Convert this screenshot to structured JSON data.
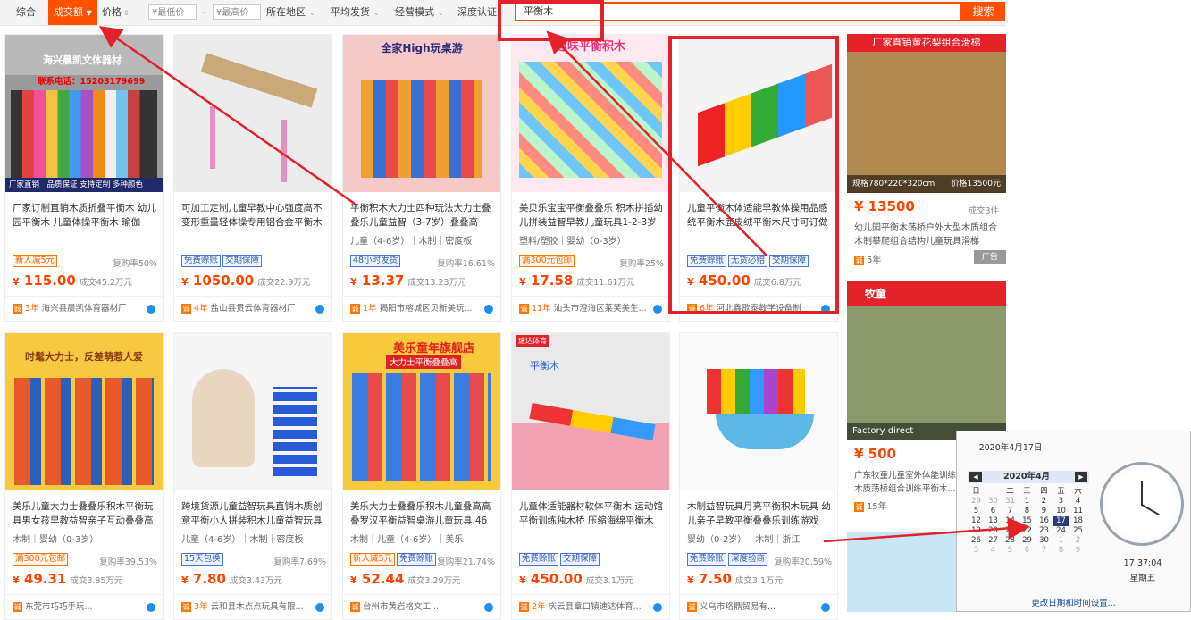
{
  "filters": {
    "zonghe": "综合",
    "chengjiao": "成交额",
    "jiage": "价格",
    "min_price": "¥最低价",
    "dash": "–",
    "max_price": "¥最高价",
    "region": "所在地区",
    "avg_ship": "平均发货",
    "mode": "经营模式",
    "cert": "深度认证"
  },
  "search": {
    "value": "平衡木",
    "button": "搜索"
  },
  "products": [
    {
      "title": "厂家订制直销木质折叠平衡木 幼儿园平衡木 儿童体操平衡木 瑜伽",
      "badges": [
        [
          "新人减5元",
          "o"
        ]
      ],
      "repurchase": "复购率50%",
      "price": "115.00",
      "sales": "成交45.2万元",
      "years": "3年",
      "shop": "海兴县晨凯体育器材厂",
      "img_top": "海兴晨凯文体器材",
      "img_top2": "联系电话：15203179699",
      "img_bottom": "厂家直销　品质保证 支持定制 多种颜色"
    },
    {
      "title": "可加工定制儿童早教中心强度高不变形重量轻体操专用铝合金平衡木",
      "badges": [
        [
          "免费赊账",
          "b"
        ],
        [
          "交期保障",
          "b"
        ]
      ],
      "repurchase": "",
      "price": "1050.00",
      "sales": "成交22.9万元",
      "years": "4年",
      "shop": "盐山县贯云体育器材厂"
    },
    {
      "title": "平衡积木大力士四种玩法大力士叠叠乐儿童益智（3-7岁）叠叠高",
      "spec": "儿童（4-6岁）｜木制｜密度板",
      "badges": [
        [
          "48小时发货",
          "b"
        ]
      ],
      "repurchase": "复购率16.61%",
      "price": "13.37",
      "sales": "成交13.23万元",
      "years": "1年",
      "shop": "揭阳市榕城区贝新美玩...",
      "img_top": "全家High玩桌游"
    },
    {
      "title": "美贝乐宝宝平衡叠叠乐 积木拼插幼儿拼装益智早教儿童玩具1-2-3岁",
      "spec": "塑料/塑胶｜婴幼（0-3岁）",
      "badges": [
        [
          "满300元包邮",
          "o"
        ]
      ],
      "repurchase": "复购率25%",
      "price": "17.58",
      "sales": "成交11.61万元",
      "years": "11年",
      "shop": "汕头市澄海区莱芙美生...",
      "img_top": "趣味平衡积木"
    },
    {
      "title": "儿童平衡木体适能早教体操用品感统平衡木鹿皮绒平衡木尺寸可订做",
      "badges": [
        [
          "免费赊账",
          "b"
        ],
        [
          "无货必赔",
          "b"
        ],
        [
          "交期保障",
          "b"
        ]
      ],
      "repurchase": "",
      "price": "450.00",
      "sales": "成交6.8万元",
      "years": "6年",
      "shop": "河北鑫歌泰教学设备制"
    },
    {
      "title": "美乐儿童大力士叠叠乐积木平衡玩具男女孩早教益智亲子互动叠叠高",
      "spec": "木制｜婴幼（0-3岁）",
      "badges": [
        [
          "满300元包邮",
          "o"
        ]
      ],
      "repurchase": "复购率39.53%",
      "price": "49.31",
      "sales": "成交3.85万元",
      "years": "",
      "shop": "东莞市巧巧手玩...",
      "img_top": "时髦大力士，反差萌惹人爱"
    },
    {
      "title": "跨境货源儿童益智玩具直销木质创意平衡小人拼装积木儿童益智玩具",
      "spec": "儿童（4-6岁）｜木制｜密度板",
      "badges": [
        [
          "15天包换",
          "b"
        ]
      ],
      "repurchase": "复购率7.69%",
      "price": "7.80",
      "sales": "成交3.43万元",
      "years": "3年",
      "shop": "云和县木点点玩具有限..."
    },
    {
      "title": "美乐大力士叠叠乐积木儿童叠高高叠罗汉平衡益智桌游儿童玩具.46",
      "spec": "木制｜儿童（4-6岁）｜美乐",
      "badges": [
        [
          "新人减5元",
          "o"
        ],
        [
          "免费赊账",
          "b"
        ]
      ],
      "repurchase": "复购率21.74%",
      "price": "52.44",
      "sales": "成交3.29万元",
      "years": "",
      "shop": "台州市黄岩格文工...",
      "img_top": "美乐童年旗舰店",
      "img_top2": "大力士平衡叠叠高"
    },
    {
      "title": "儿童体适能器材软体平衡木 运动馆平衡训练独木桥 压缩海绵平衡木",
      "badges": [
        [
          "免费赊账",
          "b"
        ],
        [
          "交期保障",
          "b"
        ]
      ],
      "repurchase": "",
      "price": "450.00",
      "sales": "成交3.1万元",
      "years": "2年",
      "shop": "庆云县章口镇速达体育...",
      "img_top": "速达体育",
      "img_top2": "平衡木"
    },
    {
      "title": "木制益智玩具月亮平衡积木玩具 幼儿亲子早教平衡叠叠乐训练游戏",
      "spec": "婴幼（0-2岁）｜木制｜浙江",
      "badges": [
        [
          "免费赊账",
          "b"
        ],
        [
          "深度验商",
          "b"
        ]
      ],
      "repurchase": "复购率20.59%",
      "price": "7.50",
      "sales": "成交3.1万元",
      "years": "",
      "shop": "义乌市珞鼎贸易有..."
    }
  ],
  "ads": [
    {
      "banner": "厂家直销黄花梨组合滑梯",
      "spec": "规格780*220*320cm",
      "spec_price": "价格13500元",
      "price": "13500",
      "sales": "成交3件",
      "title": "幼儿园平衡木荡桥户外大型木质组合木制攀爬组合结构儿童玩具滑梯",
      "years": "5年",
      "tag": "广告"
    },
    {
      "brand": "牧童",
      "caption": "Factory direct",
      "price": "500",
      "title": "广东牧童儿童室外体能训练木质荡桥组合训练平衡木...",
      "years": "15年"
    }
  ],
  "clock": {
    "date": "2020年4月17日",
    "month": "2020年4月",
    "weekdays": [
      "日",
      "一",
      "二",
      "三",
      "四",
      "五",
      "六"
    ],
    "weeks": [
      [
        "29",
        "30",
        "31",
        "1",
        "2",
        "3",
        "4"
      ],
      [
        "5",
        "6",
        "7",
        "8",
        "9",
        "10",
        "11"
      ],
      [
        "12",
        "13",
        "14",
        "15",
        "16",
        "17",
        "18"
      ],
      [
        "19",
        "20",
        "21",
        "22",
        "23",
        "24",
        "25"
      ],
      [
        "26",
        "27",
        "28",
        "29",
        "30",
        "1",
        "2"
      ],
      [
        "3",
        "4",
        "5",
        "6",
        "7",
        "8",
        "9"
      ]
    ],
    "time": "17:37:04",
    "weekday": "星期五",
    "link": "更改日期和时间设置..."
  },
  "colors": {
    "accent": "#ff5000",
    "annotation": "#e4222a",
    "price": "#ff4400"
  }
}
